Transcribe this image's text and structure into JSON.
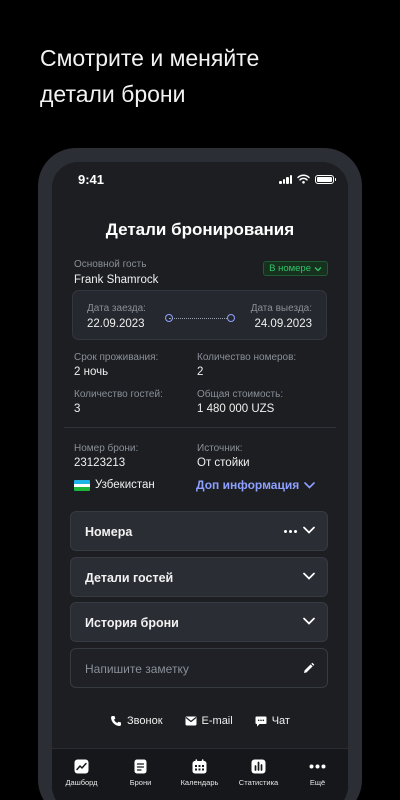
{
  "promo": {
    "line1": "Смотрите и меняйте",
    "line2": "детали брони"
  },
  "status_bar": {
    "time": "9:41"
  },
  "page": {
    "title": "Детали бронирования"
  },
  "guest": {
    "label": "Основной гость",
    "name": "Frank Shamrock",
    "status_badge": "В номере"
  },
  "dates": {
    "checkin_label": "Дата заезда:",
    "checkin_value": "22.09.2023",
    "checkout_label": "Дата выезда:",
    "checkout_value": "24.09.2023"
  },
  "stay": {
    "duration_label": "Срок проживания:",
    "duration_value": "2 ночь",
    "rooms_label": "Количество номеров:",
    "rooms_value": "2",
    "guests_label": "Количество гостей:",
    "guests_value": "3",
    "total_label": "Общая стоимость:",
    "total_value": "1 480 000 UZS"
  },
  "booking": {
    "number_label": "Номер брони:",
    "number_value": "23123213",
    "source_label": "Источник:",
    "source_value": "От стойки",
    "country": "Узбекистан",
    "more_info": "Доп информация"
  },
  "sections": {
    "rooms": "Номера",
    "guest_details": "Детали гостей",
    "history": "История брони"
  },
  "note": {
    "placeholder": "Напишите заметку"
  },
  "contacts": {
    "call": "Звонок",
    "email": "E-mail",
    "chat": "Чат"
  },
  "tabs": {
    "dashboard": "Дашборд",
    "bookings": "Брони",
    "calendar": "Календарь",
    "statistics": "Статистика",
    "more": "Ещё"
  },
  "colors": {
    "accent": "#8ea0ff",
    "status_green": "#34c26a",
    "background": "#1c1e22"
  }
}
